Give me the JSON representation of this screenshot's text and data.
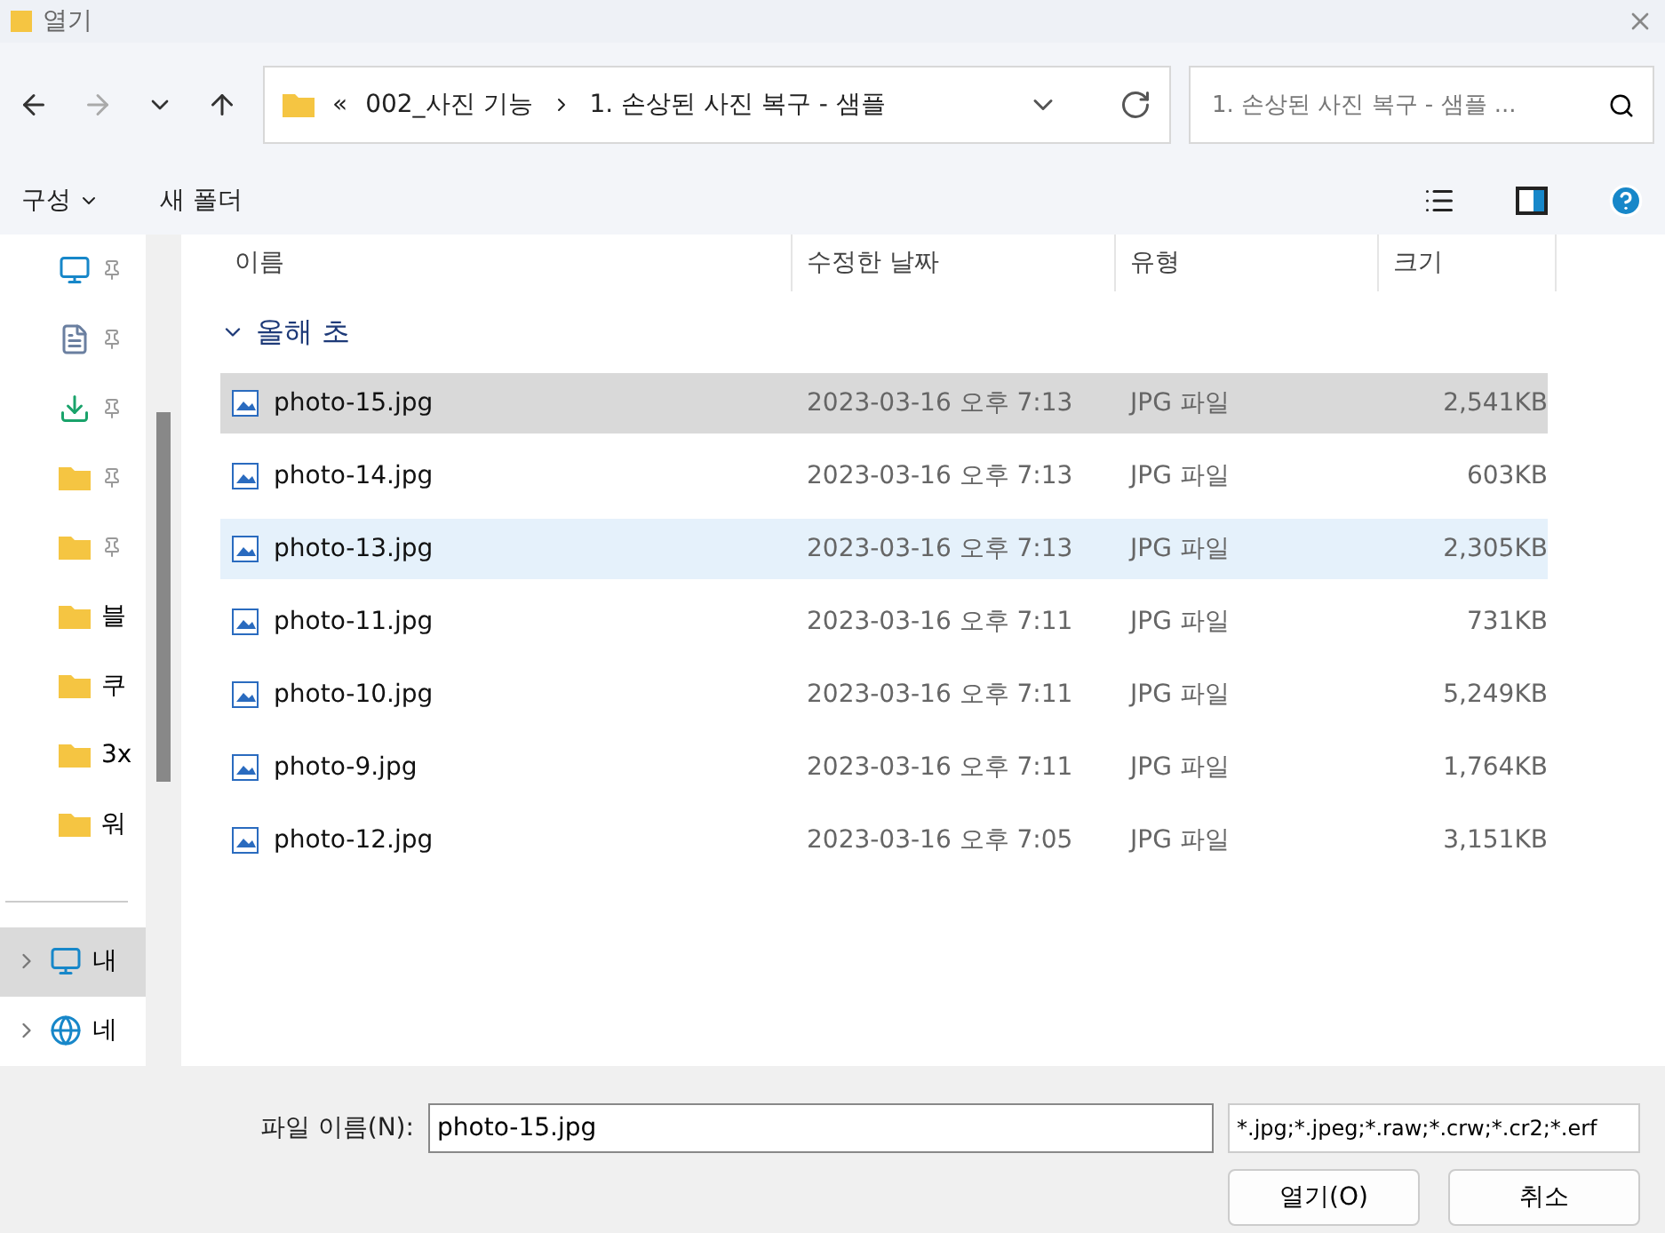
{
  "window": {
    "title": "열기"
  },
  "address": {
    "parts": [
      "«",
      "002_사진 기능",
      "1. 손상된 사진 복구 - 샘플"
    ]
  },
  "search": {
    "placeholder": "1. 손상된 사진 복구 - 샘플 ..."
  },
  "toolbar": {
    "organize": "구성",
    "new_folder": "새 폴더"
  },
  "sidebar": {
    "items": [
      {
        "kind": "desktop",
        "pinned": true,
        "selected": false
      },
      {
        "kind": "document",
        "pinned": true,
        "selected": false
      },
      {
        "kind": "download",
        "pinned": true,
        "selected": false
      },
      {
        "kind": "folder",
        "pinned": true,
        "selected": false
      },
      {
        "kind": "folder",
        "pinned": true,
        "selected": false
      },
      {
        "kind": "folder",
        "label": "블",
        "pinned": false,
        "selected": false
      },
      {
        "kind": "folder",
        "label": "쿠",
        "pinned": false,
        "selected": false
      },
      {
        "kind": "folder",
        "label": "3x",
        "pinned": false,
        "selected": false
      },
      {
        "kind": "folder",
        "label": "워",
        "pinned": false,
        "selected": false
      },
      {
        "kind": "divider"
      },
      {
        "kind": "pc",
        "label": "내",
        "pinned": false,
        "selected": true
      },
      {
        "kind": "network",
        "label": "네",
        "pinned": false,
        "selected": false
      }
    ]
  },
  "table": {
    "columns": [
      "이름",
      "수정한 날짜",
      "유형",
      "크기"
    ],
    "group": {
      "label": "올해 초",
      "expanded": true
    },
    "rows": [
      {
        "name": "photo-15.jpg",
        "date": "2023-03-16 오후 7:13",
        "type": "JPG 파일",
        "size": "2,541KB",
        "selected": true,
        "hovered": false
      },
      {
        "name": "photo-14.jpg",
        "date": "2023-03-16 오후 7:13",
        "type": "JPG 파일",
        "size": "603KB",
        "selected": false,
        "hovered": false
      },
      {
        "name": "photo-13.jpg",
        "date": "2023-03-16 오후 7:13",
        "type": "JPG 파일",
        "size": "2,305KB",
        "selected": false,
        "hovered": true
      },
      {
        "name": "photo-11.jpg",
        "date": "2023-03-16 오후 7:11",
        "type": "JPG 파일",
        "size": "731KB",
        "selected": false,
        "hovered": false
      },
      {
        "name": "photo-10.jpg",
        "date": "2023-03-16 오후 7:11",
        "type": "JPG 파일",
        "size": "5,249KB",
        "selected": false,
        "hovered": false
      },
      {
        "name": "photo-9.jpg",
        "date": "2023-03-16 오후 7:11",
        "type": "JPG 파일",
        "size": "1,764KB",
        "selected": false,
        "hovered": false
      },
      {
        "name": "photo-12.jpg",
        "date": "2023-03-16 오후 7:05",
        "type": "JPG 파일",
        "size": "3,151KB",
        "selected": false,
        "hovered": false
      }
    ]
  },
  "footer": {
    "filename_label": "파일 이름(N):",
    "filename": "photo-15.jpg",
    "filter": "*.jpg;*.jpeg;*.raw;*.crw;*.cr2;*.erf",
    "open": "열기(O)",
    "cancel": "취소"
  }
}
